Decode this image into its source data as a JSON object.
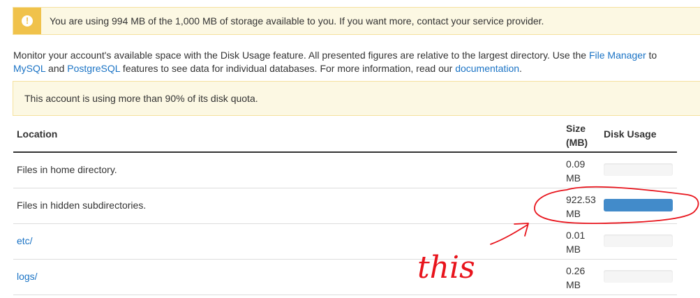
{
  "storage_banner": {
    "icon": "exclamation-circle-icon",
    "icon_glyph": "!",
    "text": "You are using 994 MB of the 1,000 MB of storage available to you. If you want more, contact your service provider."
  },
  "description": {
    "part1": "Monitor your account's available space with the Disk Usage feature. All presented figures are relative to the largest directory. Use the ",
    "file_manager_link": "File Manager",
    "part2": " to",
    "mysql_link": "MySQL",
    "part3": " and ",
    "postgresql_link": "PostgreSQL",
    "part4": " features to see data for individual databases. For more information, read our ",
    "documentation_link": "documentation",
    "part5": "."
  },
  "quota_alert": {
    "text": "This account is using more than 90% of its disk quota."
  },
  "table": {
    "headers": {
      "location": "Location",
      "size_line1": "Size",
      "size_line2": "(MB)",
      "disk_usage": "Disk Usage"
    },
    "rows": [
      {
        "location": "Files in home directory.",
        "size_value": "0.09",
        "size_unit": "MB",
        "usage_fraction": 0.0
      },
      {
        "location": "Files in hidden subdirectories.",
        "size_value": "922.53",
        "size_unit": "MB",
        "usage_fraction": 1.0
      },
      {
        "location": "etc/",
        "size_value": "0.01",
        "size_unit": "MB",
        "usage_fraction": 0.0
      },
      {
        "location": "logs/",
        "size_value": "0.26",
        "size_unit": "MB",
        "usage_fraction": 0.0
      }
    ]
  },
  "annotation": {
    "handwritten_text": "this",
    "color": "#e8141c"
  },
  "colors": {
    "banner_bg": "#fcf8e3",
    "warning": "#f0c24b",
    "link": "#1a73c5",
    "bar_fill": "#428bca"
  }
}
